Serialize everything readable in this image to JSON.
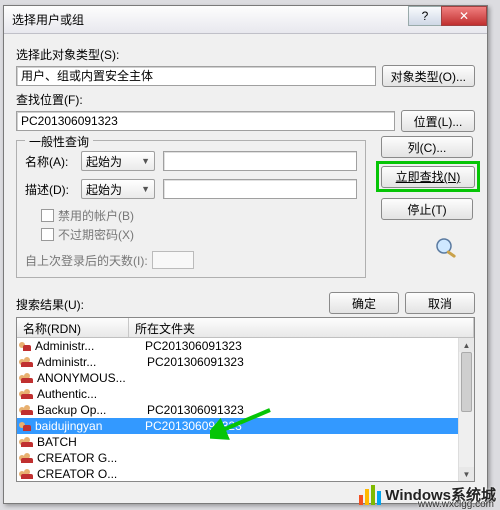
{
  "window": {
    "title": "选择用户或组"
  },
  "section": {
    "object_type_label": "选择此对象类型(S):",
    "object_type_value": "用户、组或内置安全主体",
    "object_type_button": "对象类型(O)...",
    "location_label": "查找位置(F):",
    "location_value": "PC201306091323",
    "location_button": "位置(L)..."
  },
  "common": {
    "legend": "一般性查询",
    "name_label": "名称(A):",
    "name_combo": "起始为",
    "desc_label": "描述(D):",
    "desc_combo": "起始为",
    "chk_disabled": "禁用的帐户(B)",
    "chk_noexpire": "不过期密码(X)",
    "lastlogon_label": "自上次登录后的天数(I):"
  },
  "rightbuttons": {
    "columns": "列(C)...",
    "findnow": "立即查找(N)",
    "stop": "停止(T)"
  },
  "results": {
    "label": "搜索结果(U):",
    "ok": "确定",
    "cancel": "取消",
    "col_name": "名称(RDN)",
    "col_folder": "所在文件夹",
    "rows": [
      {
        "type": "user",
        "name": "Administr...",
        "folder": "PC201306091323",
        "sel": false
      },
      {
        "type": "group",
        "name": "Administr...",
        "folder": "PC201306091323",
        "sel": false
      },
      {
        "type": "group",
        "name": "ANONYMOUS...",
        "folder": "",
        "sel": false
      },
      {
        "type": "group",
        "name": "Authentic...",
        "folder": "",
        "sel": false
      },
      {
        "type": "group",
        "name": "Backup Op...",
        "folder": "PC201306091323",
        "sel": false
      },
      {
        "type": "user",
        "name": "baidujingyan",
        "folder": "PC201306091323",
        "sel": true
      },
      {
        "type": "group",
        "name": "BATCH",
        "folder": "",
        "sel": false
      },
      {
        "type": "group",
        "name": "CREATOR G...",
        "folder": "",
        "sel": false
      },
      {
        "type": "group",
        "name": "CREATOR O...",
        "folder": "",
        "sel": false
      }
    ]
  },
  "watermark": {
    "main": "Windows系统城",
    "sub": "www.wxclgg.com"
  }
}
